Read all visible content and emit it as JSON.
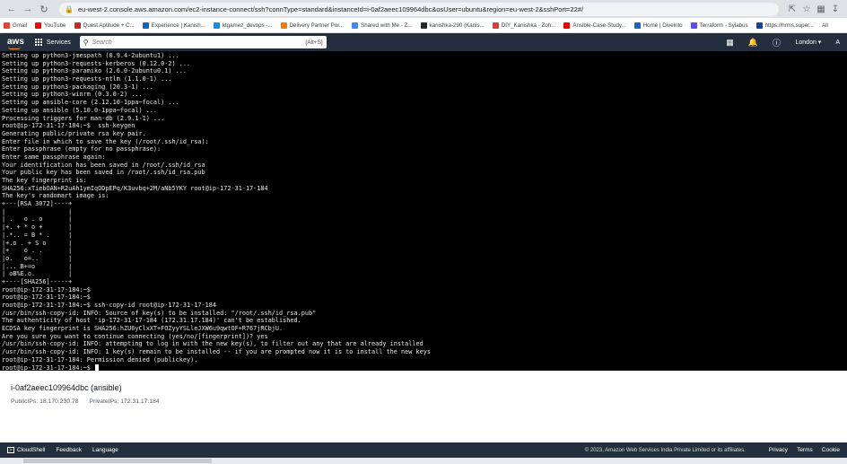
{
  "browser": {
    "url": "eu-west-2.console.aws.amazon.com/ec2-instance-connect/ssh?connType=standard&instanceId=i-0af2aeec109964dbc&osUser=ubuntu&region=eu-west-2&sshPort=22#/",
    "icons": [
      "back-icon",
      "forward-icon",
      "reload-icon",
      "lock-icon",
      "share-icon",
      "star-icon",
      "puzzle-icon",
      "download-icon"
    ]
  },
  "bookmarks": [
    {
      "label": "Gmail",
      "color": "#ea4335"
    },
    {
      "label": "YouTube",
      "color": "#ff0000"
    },
    {
      "label": "Quest Aptitude + C...",
      "color": "#c62828"
    },
    {
      "label": "Experience | Kanish...",
      "color": "#0a66c2"
    },
    {
      "label": "ktgamez_devops -...",
      "color": "#1e88e5"
    },
    {
      "label": "Delivery Partner Por...",
      "color": "#f57c00"
    },
    {
      "label": "Shared with Me - Z...",
      "color": "#4285f4"
    },
    {
      "label": "kanishka-290 (Kanis...",
      "color": "#24292e"
    },
    {
      "label": "DIY_Kanishka - Zoh...",
      "color": "#e53935"
    },
    {
      "label": "Ansible-Case-Study...",
      "color": "#ee0000"
    },
    {
      "label": "Home | Divelnto",
      "color": "#1565c0"
    },
    {
      "label": "Terraform - Sylabus",
      "color": "#5c4ee5"
    },
    {
      "label": "https://hrms.super...",
      "color": "#0d47a1"
    },
    {
      "label": "All",
      "color": "#9e9e9e"
    }
  ],
  "aws": {
    "logo": "aws",
    "services_label": "Services",
    "search_placeholder": "Search",
    "search_shortcut": "[Alt+S]",
    "region": "London ▾",
    "cut_label": "A"
  },
  "terminal": {
    "lines": [
      "Setting up python3-jmespath (0.9.4-2ubuntu1) ...",
      "Setting up python3-requests-kerberos (0.12.0-2) ...",
      "Setting up python3-paramiko (2.6.0-2ubuntu0.1) ...",
      "Setting up python3-requests-ntlm (1.1.0-1) ...",
      "Setting up python3-packaging (20.3-1) ...",
      "Setting up python3-winrm (0.3.0-2) ...",
      "Setting up ansible-core (2.12.10-1ppa~focal) ...",
      "Setting up ansible (5.10.0-1ppa~focal) ...",
      "Processing triggers for man-db (2.9.1-1) ...",
      "root@ip-172-31-17-184:~$  ssh-keygen",
      "Generating public/private rsa key pair.",
      "Enter file in which to save the key (/root/.ssh/id_rsa):",
      "Enter passphrase (empty for no passphrase):",
      "Enter same passphrase again:",
      "Your identification has been saved in /root/.ssh/id_rsa",
      "Your public key has been saved in /root/.ssh/id_rsa.pub",
      "The key fingerprint is:",
      "SHA256:xTiebOAN+R2uAh1ymIqODpEPq/K3uvbq+2M/aNb5YKY root@ip-172-31-17-184",
      "The key's randomart image is:",
      "+---[RSA 3072]----+",
      "|                 |",
      "| .   o . o       |",
      "|+. + * o +       |",
      "|.*.. = B * .     |",
      "|+.o . + S o      |",
      "|+    o . .       |",
      "|o.   o=..        |",
      "|... B+=o         |",
      "| oB%E.o.         |",
      "+----[SHA256]-----+",
      "root@ip-172-31-17-184:~$",
      "root@ip-172-31-17-184:~$",
      "root@ip-172-31-17-184:~$ ssh-copy-id root@ip-172-31-17-184",
      "/usr/bin/ssh-copy-id: INFO: Source of key(s) to be installed: \"/root/.ssh/id_rsa.pub\"",
      "The authenticity of host 'ip-172-31-17-184 (172.31.17.184)' can't be established.",
      "ECDSA key fingerprint is SHA256:hZU6yClxXT+FOZyyYSLleJXW6u9qwtOF+R767jRCbjU.",
      "Are you sure you want to continue connecting (yes/no/[fingerprint])? yes",
      "/usr/bin/ssh-copy-id: INFO: attempting to log in with the new key(s), to filter out any that are already installed",
      "/usr/bin/ssh-copy-id: INFO: 1 key(s) remain to be installed -- if you are prompted now it is to install the new keys",
      "root@ip-172-31-17-184: Permission denied (publickey).",
      "root@ip-172-31-17-184:~$ "
    ]
  },
  "instance": {
    "title": "i-0af2aeec109964dbc (ansible)",
    "public_ips": "PublicIPs: 18.170.230.78",
    "private_ips": "PrivateIPs: 172.31.17.184"
  },
  "footer": {
    "cloudshell": "CloudShell",
    "feedback": "Feedback",
    "language": "Language",
    "copyright": "© 2023, Amazon Web Services India Private Limited or its affiliates.",
    "privacy": "Privacy",
    "terms": "Terms",
    "cookie": "Cookie"
  }
}
